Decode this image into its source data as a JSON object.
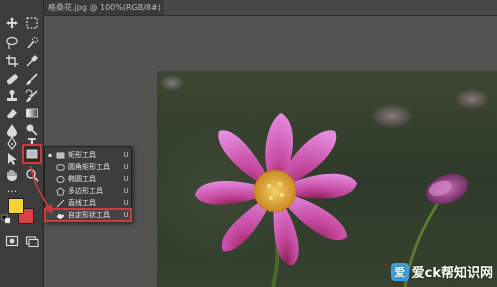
{
  "document": {
    "tab_title": "格桑花.jpg @ 100%(RGB/8#)"
  },
  "toolbar": {
    "tools": [
      {
        "name": "move-tool",
        "icon": "move-icon"
      },
      {
        "name": "marquee-tool",
        "icon": "marquee-icon"
      },
      {
        "name": "lasso-tool",
        "icon": "lasso-icon"
      },
      {
        "name": "quick-select-tool",
        "icon": "quick-select-icon"
      },
      {
        "name": "crop-tool",
        "icon": "crop-icon"
      },
      {
        "name": "eyedropper-tool",
        "icon": "eyedropper-icon"
      },
      {
        "name": "healing-brush-tool",
        "icon": "bandage-icon"
      },
      {
        "name": "brush-tool",
        "icon": "brush-icon"
      },
      {
        "name": "clone-stamp-tool",
        "icon": "stamp-icon"
      },
      {
        "name": "history-brush-tool",
        "icon": "history-brush-icon"
      },
      {
        "name": "eraser-tool",
        "icon": "eraser-icon"
      },
      {
        "name": "gradient-tool",
        "icon": "gradient-icon"
      },
      {
        "name": "blur-tool",
        "icon": "drop-icon"
      },
      {
        "name": "dodge-tool",
        "icon": "dodge-icon"
      },
      {
        "name": "pen-tool",
        "icon": "pen-icon"
      },
      {
        "name": "type-tool",
        "icon": "type-icon"
      },
      {
        "name": "path-select-tool",
        "icon": "arrow-icon"
      },
      {
        "name": "shape-tool",
        "icon": "rectangle-icon"
      },
      {
        "name": "hand-tool",
        "icon": "hand-icon"
      },
      {
        "name": "zoom-tool",
        "icon": "zoom-icon"
      }
    ],
    "type_glyph": "T",
    "foreground_color": "#f2d435",
    "background_color": "#d8424a"
  },
  "shape_menu": {
    "items": [
      {
        "label": "矩形工具",
        "shortcut": "U",
        "icon": "rectangle-icon",
        "active": true
      },
      {
        "label": "圆角矩形工具",
        "shortcut": "U",
        "icon": "rounded-rectangle-icon",
        "active": false
      },
      {
        "label": "椭圆工具",
        "shortcut": "U",
        "icon": "ellipse-icon",
        "active": false
      },
      {
        "label": "多边形工具",
        "shortcut": "U",
        "icon": "polygon-icon",
        "active": false
      },
      {
        "label": "直线工具",
        "shortcut": "U",
        "icon": "line-icon",
        "active": false
      },
      {
        "label": "自定形状工具",
        "shortcut": "U",
        "icon": "custom-shape-icon",
        "active": false
      }
    ],
    "active_marker": "▪"
  },
  "watermark": {
    "logo_glyph": "爱",
    "text": "爱ck帮知识网"
  },
  "colors": {
    "annotation_red": "#d23a3a",
    "petal_pink": "#e079d0",
    "center_yellow": "#e7b04a"
  }
}
